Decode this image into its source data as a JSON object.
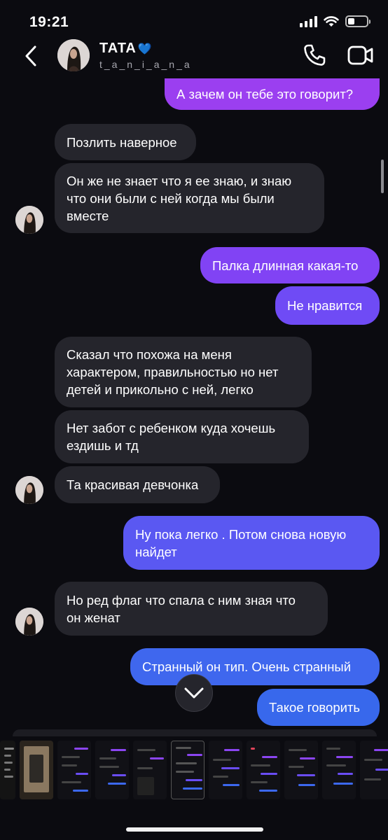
{
  "status": {
    "time": "19:21",
    "battery_level": 0.35,
    "icons": [
      "cellular-signal-icon",
      "wifi-icon",
      "battery-icon"
    ]
  },
  "header": {
    "name": "TATA",
    "verified_badge": "💙",
    "username": "t_a_n_i_a_n_a"
  },
  "messages": [
    {
      "direction": "out",
      "text": "А зачем он тебе это говорит?"
    },
    {
      "direction": "in",
      "text": "Позлить наверное"
    },
    {
      "direction": "in",
      "lines": [
        "Он же не знает что я ее знаю, и знаю",
        "что они были с ней когда мы были",
        "вместе"
      ]
    },
    {
      "direction": "out",
      "text": "Палка длинная какая-то"
    },
    {
      "direction": "out",
      "text": "Не нравится"
    },
    {
      "direction": "in",
      "lines": [
        "Сказал что похожа на меня",
        "характером, правильностью но нет",
        "детей и прикольно с ней, легко"
      ]
    },
    {
      "direction": "in",
      "lines": [
        "Нет забот с ребенком куда хочешь",
        "ездишь и тд"
      ]
    },
    {
      "direction": "in",
      "text": "Та красивая девчонка"
    },
    {
      "direction": "out",
      "lines": [
        "Ну пока легко . Потом снова новую",
        "найдет"
      ]
    },
    {
      "direction": "in",
      "lines": [
        "Но ред флаг что спала с ним зная что",
        "он женат"
      ]
    },
    {
      "direction": "out",
      "text": "Странный он тип. Очень странный"
    },
    {
      "direction": "out",
      "text": "Такое говорить"
    }
  ],
  "colors": {
    "background": "#0b0b10",
    "incoming_bubble": "#25252c",
    "outgoing_top": "#9b3ff0",
    "outgoing_bottom": "#3868ec"
  }
}
